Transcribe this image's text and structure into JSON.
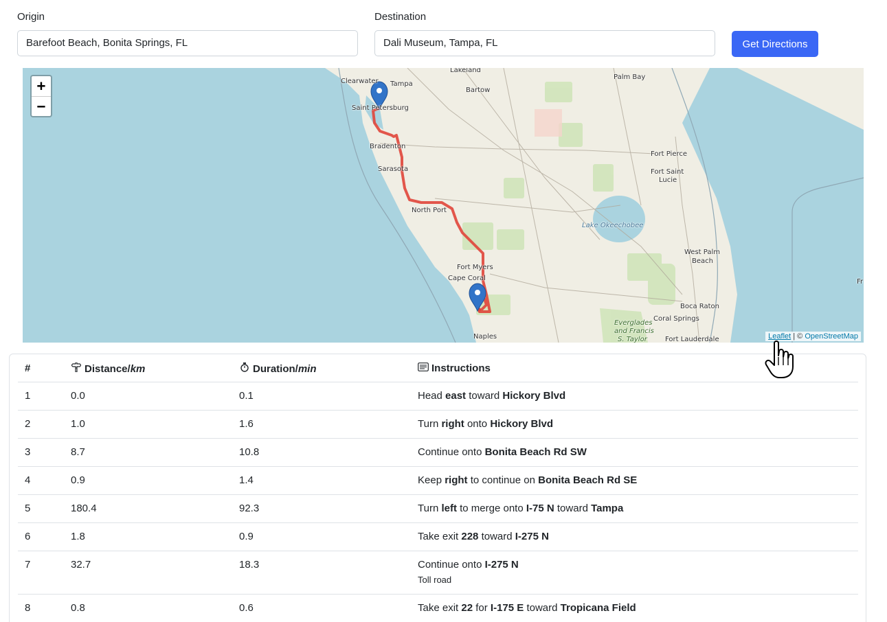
{
  "form": {
    "origin_label": "Origin",
    "origin_value": "Barefoot Beach, Bonita Springs, FL",
    "destination_label": "Destination",
    "destination_value": "Dali Museum, Tampa, FL",
    "button_label": "Get Directions"
  },
  "map": {
    "zoom_in": "+",
    "zoom_out": "−",
    "labels": {
      "lakeland": "Lakeland",
      "clearwater": "Clearwater",
      "tampa": "Tampa",
      "bartow": "Bartow",
      "palm_bay": "Palm Bay",
      "saint_petersburg": "Saint Petersburg",
      "bradenton": "Bradenton",
      "sarasota": "Sarasota",
      "fort_pierce": "Fort Pierce",
      "fort_saint": "Fort Saint",
      "lucie": "Lucie",
      "north_port": "North Port",
      "lake_okeechobee": "Lake Okeechobee",
      "fort_myers": "Fort Myers",
      "cape_coral": "Cape Coral",
      "west_palm": "West Palm",
      "beach": "Beach",
      "boca_raton": "Boca Raton",
      "coral_springs": "Coral Springs",
      "everglades": "Everglades",
      "and_francis": "and Francis",
      "s_taylor": "S. Taylor",
      "naples": "Naples",
      "fort_lauderdale": "Fort Lauderdale",
      "fr": "Fr"
    },
    "attribution_leaflet": "Leaflet",
    "attribution_sep": " | © ",
    "attribution_osm": "OpenStreetMap",
    "colors": {
      "water": "#aad3df",
      "land": "#f0eee4",
      "route": "#e0453a",
      "marker": "#3274c8"
    }
  },
  "table": {
    "headers": {
      "num": "#",
      "distance": "Distance/",
      "distance_unit": "km",
      "duration": "Duration/",
      "duration_unit": "min",
      "instructions": "Instructions"
    },
    "icons": {
      "distance": "signpost-icon",
      "duration": "stopwatch-icon",
      "instructions": "text-box-icon"
    },
    "rows": [
      {
        "num": "1",
        "distance": "0.0",
        "duration": "0.1",
        "parts": [
          "Head ",
          "east",
          " toward ",
          "Hickory Blvd"
        ]
      },
      {
        "num": "2",
        "distance": "1.0",
        "duration": "1.6",
        "parts": [
          "Turn ",
          "right",
          " onto ",
          "Hickory Blvd"
        ]
      },
      {
        "num": "3",
        "distance": "8.7",
        "duration": "10.8",
        "parts": [
          "Continue onto ",
          "Bonita Beach Rd SW"
        ]
      },
      {
        "num": "4",
        "distance": "0.9",
        "duration": "1.4",
        "parts": [
          "Keep ",
          "right",
          " to continue on ",
          "Bonita Beach Rd SE"
        ]
      },
      {
        "num": "5",
        "distance": "180.4",
        "duration": "92.3",
        "parts": [
          "Turn ",
          "left",
          " to merge onto ",
          "I-75 N",
          " toward ",
          "Tampa"
        ]
      },
      {
        "num": "6",
        "distance": "1.8",
        "duration": "0.9",
        "parts": [
          "Take exit ",
          "228",
          " toward ",
          "I-275 N"
        ]
      },
      {
        "num": "7",
        "distance": "32.7",
        "duration": "18.3",
        "parts": [
          "Continue onto ",
          "I-275 N"
        ],
        "note": "Toll road"
      },
      {
        "num": "8",
        "distance": "0.8",
        "duration": "0.6",
        "parts": [
          "Take exit ",
          "22",
          " for ",
          "I-175 E",
          " toward ",
          "Tropicana Field"
        ]
      }
    ]
  }
}
